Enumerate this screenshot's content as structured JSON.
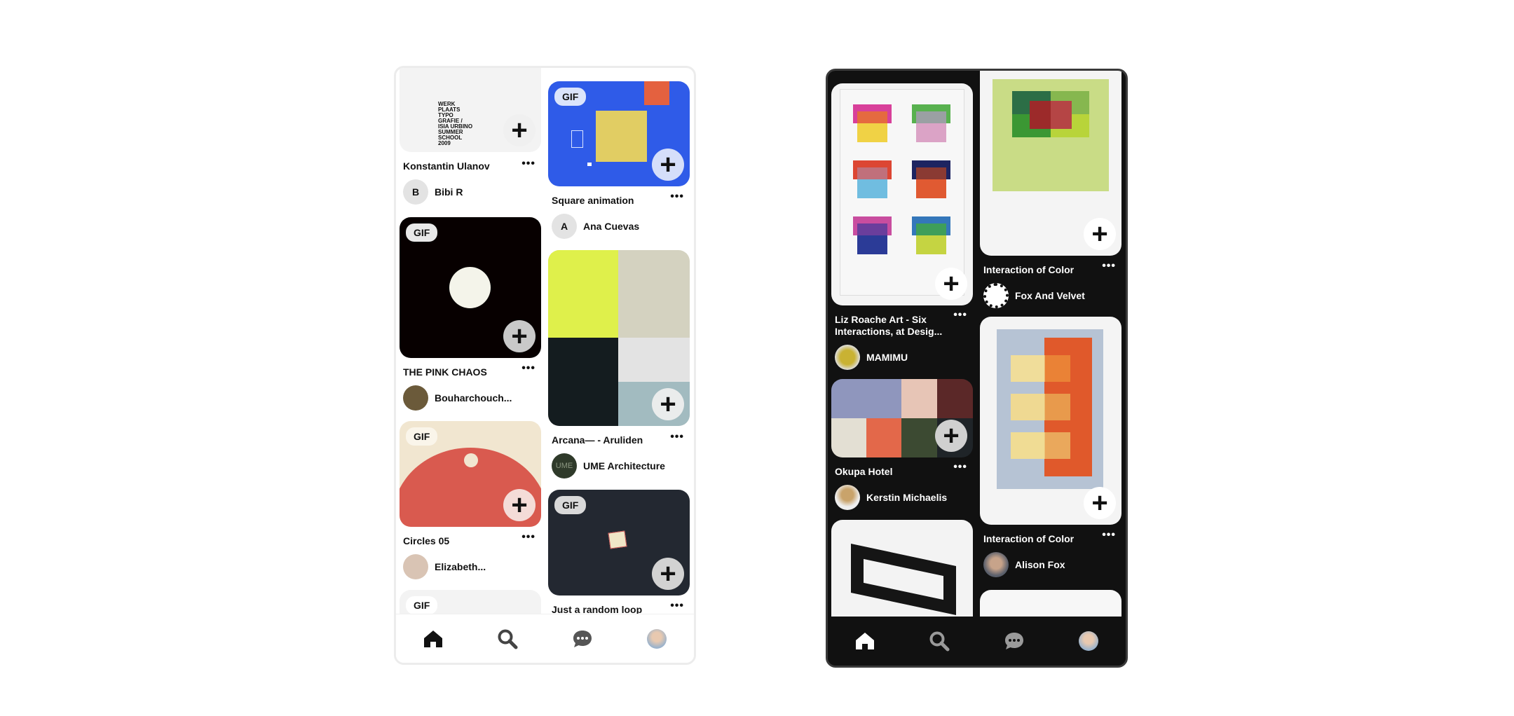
{
  "light": {
    "left": [
      {
        "title": "Konstantin Ulanov",
        "author": "Bibi R",
        "avatar_letter": "B",
        "poster_text": "WERK PLAATS TYPO GRAFIE / ISIA URBINO SUMMER SCHOOL 2009"
      },
      {
        "gif": "GIF",
        "title": "THE PINK CHAOS",
        "author": "Bouharchouch..."
      },
      {
        "gif": "GIF",
        "title": "Circles 05",
        "author": "Elizabeth..."
      },
      {
        "gif": "GIF"
      }
    ],
    "right": [
      {
        "gif": "GIF",
        "title": "Square animation",
        "author": "Ana Cuevas",
        "avatar_letter": "A"
      },
      {
        "title": "Arcana— - Aruliden",
        "author": "UME Architecture",
        "avatar_text": "UME"
      },
      {
        "gif": "GIF",
        "title": "Just a random loop"
      }
    ]
  },
  "dark": {
    "left": [
      {
        "title": "Liz Roache Art - Six Interactions, at Desig...",
        "author": "MAMIMU"
      },
      {
        "title": "Okupa Hotel",
        "author": "Kerstin Michaelis"
      },
      {}
    ],
    "right": [
      {
        "title": "Interaction of Color",
        "author": "Fox And Velvet"
      },
      {
        "title": "Interaction of Color",
        "author": "Alison Fox"
      },
      {}
    ]
  },
  "nav": [
    "home-icon",
    "search-icon",
    "messages-icon",
    "profile-avatar"
  ],
  "colors": {
    "blue": "#2f5be8",
    "black": "#070000",
    "red": "#d95a4f",
    "navy": "#232831",
    "dark_bg": "#111111"
  }
}
